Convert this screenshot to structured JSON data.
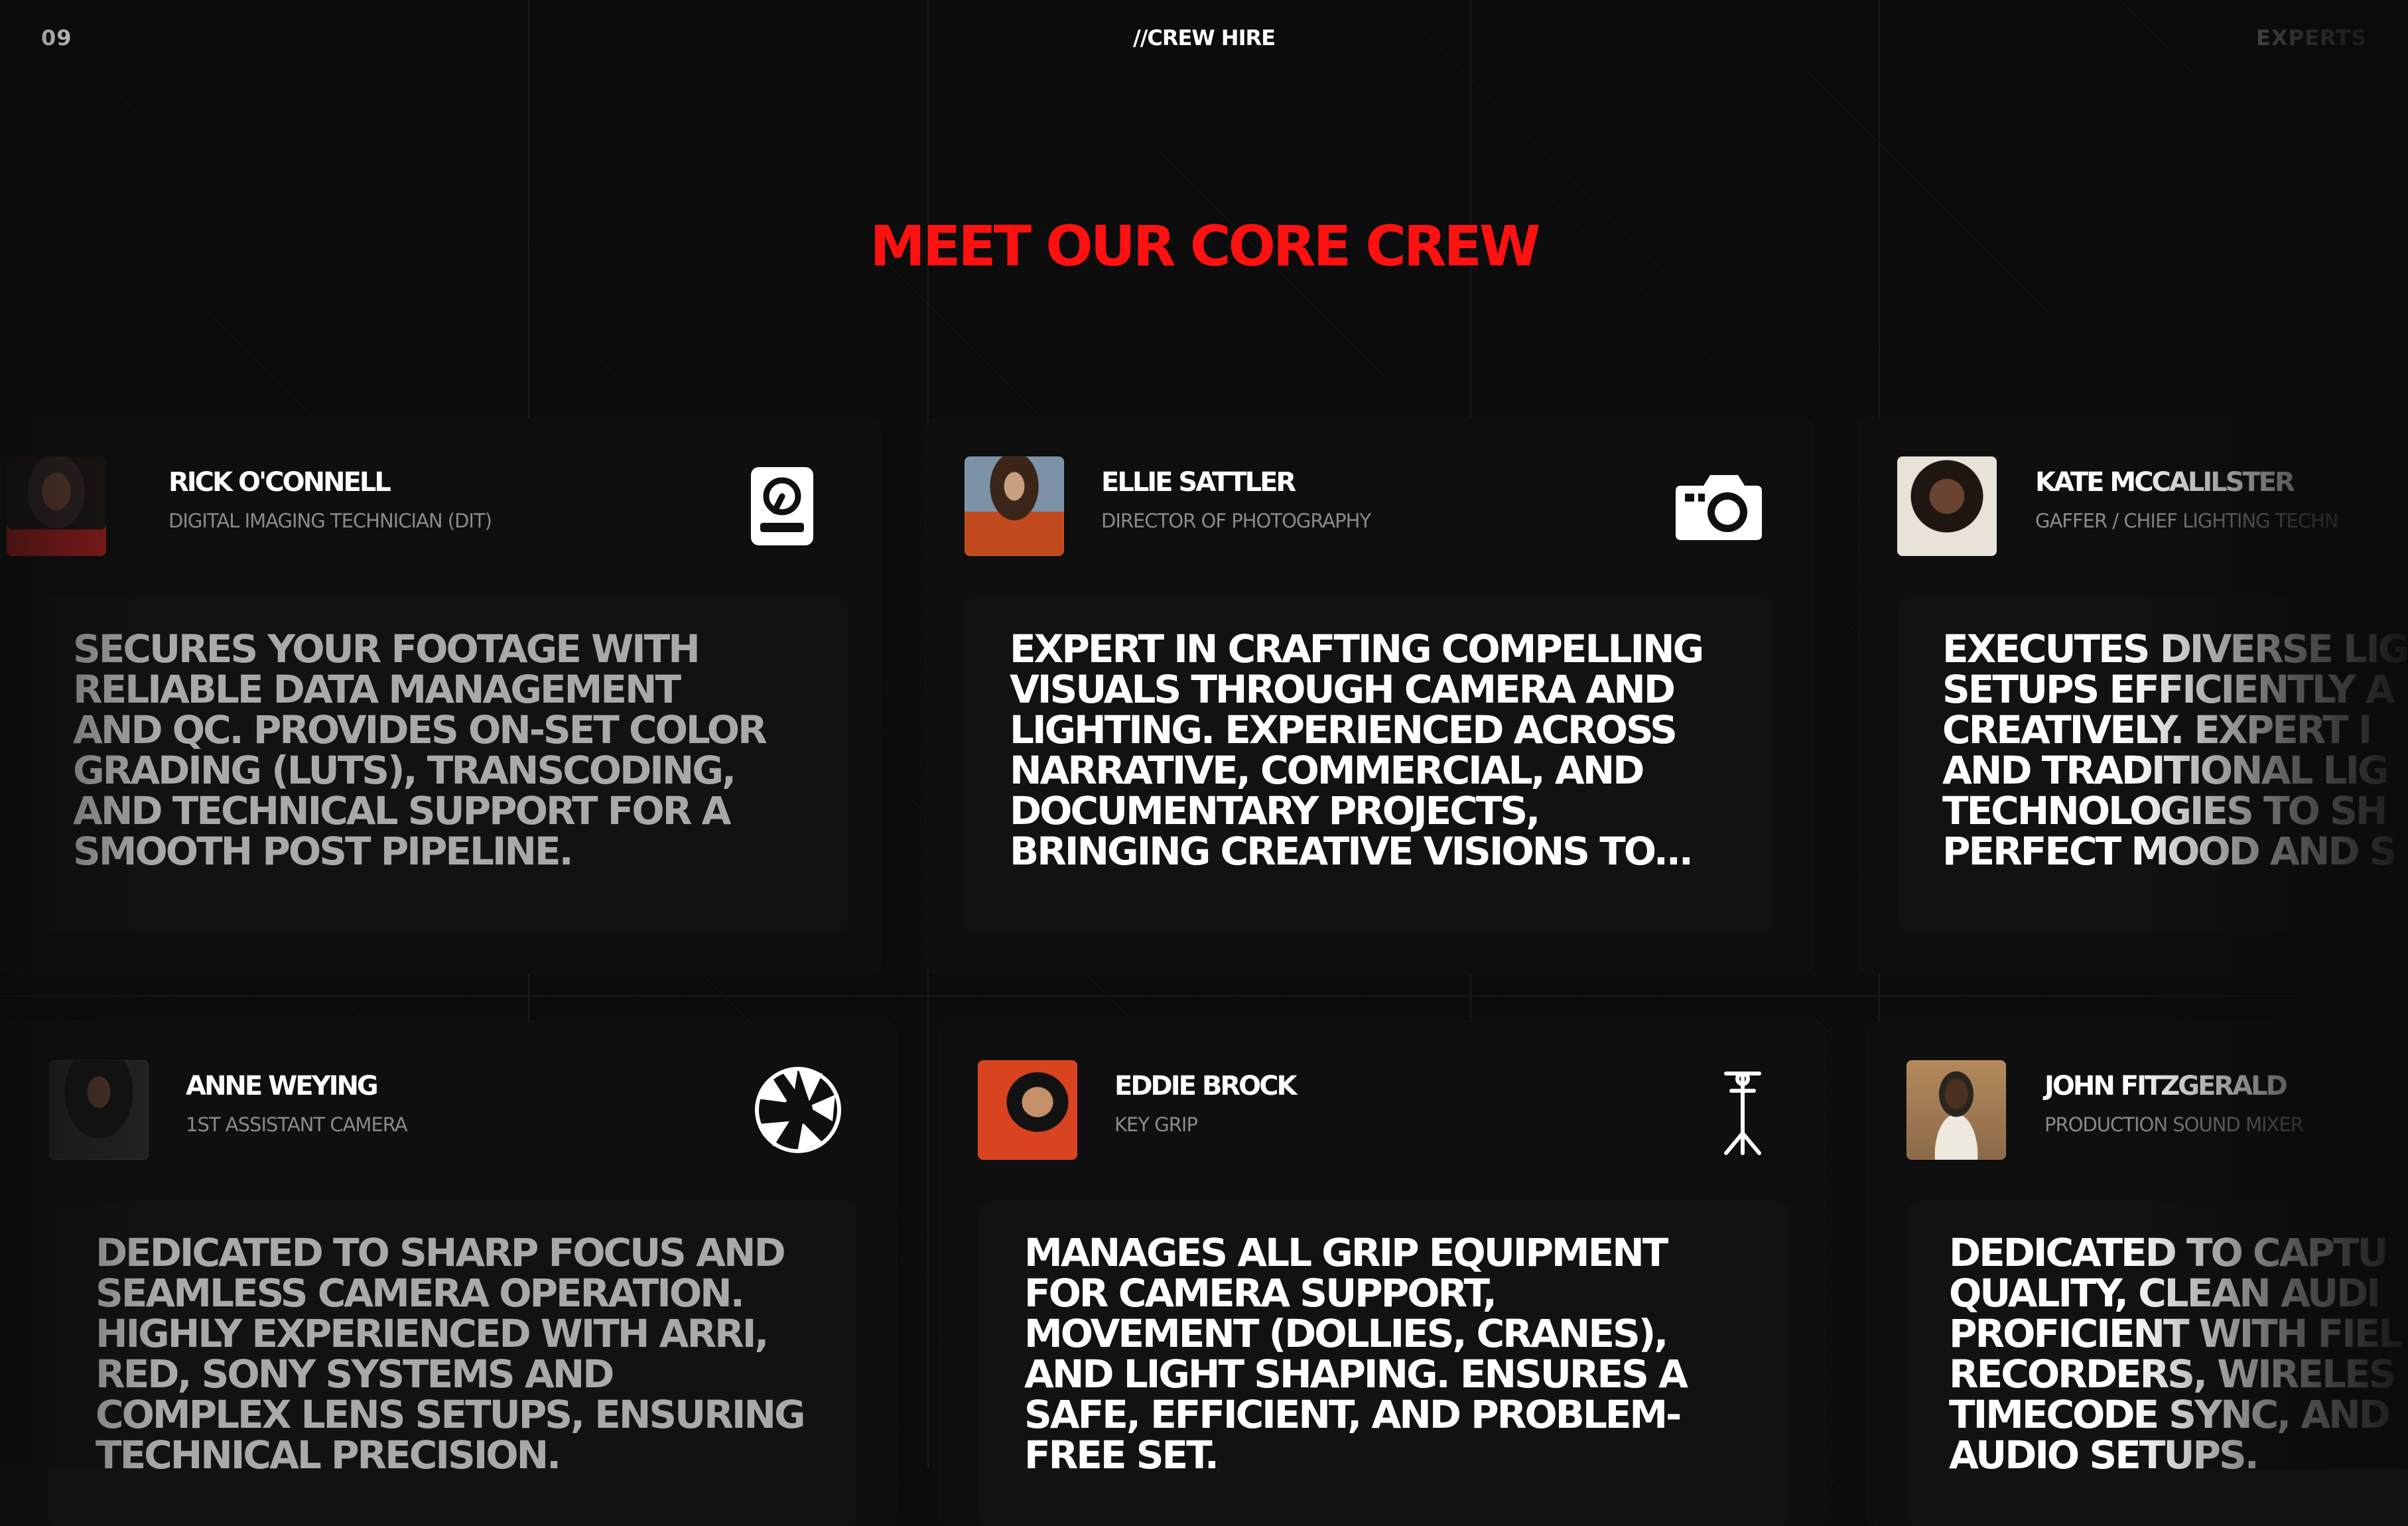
{
  "header": {
    "section_number": "09",
    "section_title": "//CREW HIRE",
    "section_label": "EXPERTS"
  },
  "title": "MEET OUR CORE CREW",
  "crew": [
    {
      "name": "RICK O'CONNELL",
      "role": "DIGITAL IMAGING TECHNICIAN (DIT)",
      "icon": "hard-drive-icon",
      "description": "SECURES YOUR FOOTAGE WITH\nRELIABLE DATA MANAGEMENT\nAND QC. PROVIDES ON-SET COLOR\nGRADING (LUTS), TRANSCODING,\nAND TECHNICAL SUPPORT FOR A\nSMOOTH POST PIPELINE."
    },
    {
      "name": "ELLIE SATTLER",
      "role": "DIRECTOR OF PHOTOGRAPHY",
      "icon": "camera-icon",
      "description": "EXPERT IN CRAFTING COMPELLING\nVISUALS THROUGH CAMERA AND\nLIGHTING. EXPERIENCED ACROSS\nNARRATIVE, COMMERCIAL, AND\nDOCUMENTARY PROJECTS,\nBRINGING CREATIVE VISIONS TO..."
    },
    {
      "name": "KATE MCCALILSTER",
      "role": "GAFFER / CHIEF LIGHTING TECHN",
      "icon": "light-icon",
      "description": "EXECUTES DIVERSE LIG\nSETUPS EFFICIENTLY A\nCREATIVELY. EXPERT I\nAND TRADITIONAL LIG\nTECHNOLOGIES TO SH\nPERFECT MOOD AND S"
    },
    {
      "name": "ANNE WEYING",
      "role": "1ST ASSISTANT CAMERA",
      "icon": "aperture-icon",
      "description": "DEDICATED TO SHARP FOCUS AND\nSEAMLESS CAMERA OPERATION.\nHIGHLY EXPERIENCED WITH ARRI,\nRED, SONY SYSTEMS AND\nCOMPLEX LENS SETUPS, ENSURING\nTECHNICAL PRECISION."
    },
    {
      "name": "EDDIE BROCK",
      "role": "KEY GRIP",
      "icon": "c-stand-icon",
      "description": "MANAGES ALL GRIP EQUIPMENT\nFOR CAMERA SUPPORT,\nMOVEMENT (DOLLIES, CRANES),\nAND LIGHT SHAPING. ENSURES A\nSAFE, EFFICIENT, AND PROBLEM-\nFREE SET."
    },
    {
      "name": "JOHN FITZGERALD",
      "role": "PRODUCTION SOUND MIXER",
      "icon": "microphone-icon",
      "description": "DEDICATED TO CAPTU\nQUALITY, CLEAN AUDI\nPROFICIENT WITH FIEL\nRECORDERS, WIRELES\nTIMECODE SYNC, AND\nAUDIO SETUPS."
    }
  ],
  "colors": {
    "accent": "#ff1111",
    "background": "#0b0b0b",
    "card": "#0f0f0f",
    "muted_text": "#8a8a8a"
  }
}
